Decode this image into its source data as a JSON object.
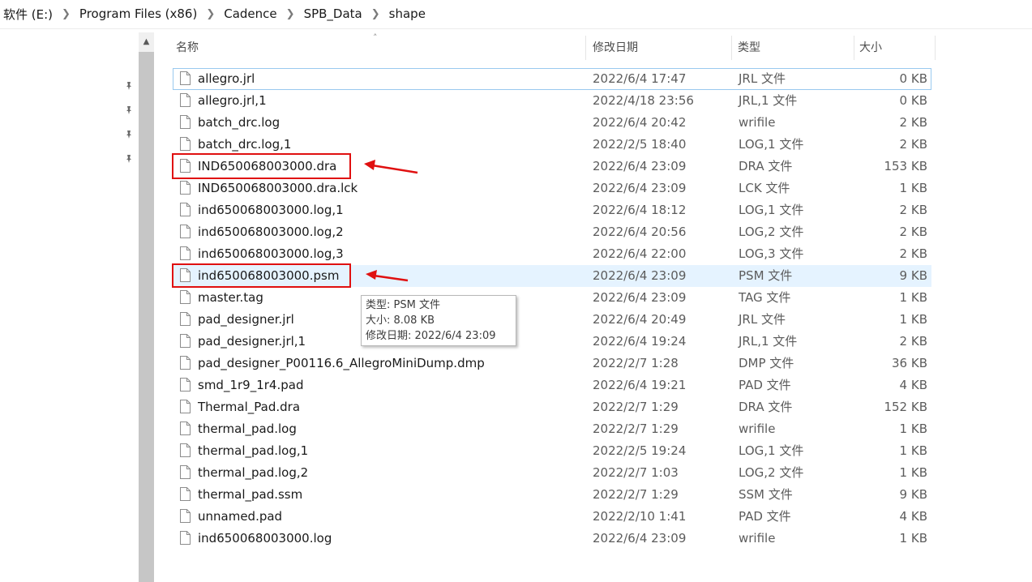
{
  "breadcrumb": [
    "软件 (E:)",
    "Program Files (x86)",
    "Cadence",
    "SPB_Data",
    "shape"
  ],
  "columns": {
    "name": "名称",
    "modified": "修改日期",
    "type": "类型",
    "size": "大小"
  },
  "files": [
    {
      "name": "allegro.jrl",
      "date": "2022/6/4 17:47",
      "type": "JRL 文件",
      "size": "0 KB"
    },
    {
      "name": "allegro.jrl,1",
      "date": "2022/4/18 23:56",
      "type": "JRL,1 文件",
      "size": "0 KB"
    },
    {
      "name": "batch_drc.log",
      "date": "2022/6/4 20:42",
      "type": "wrifile",
      "size": "2 KB"
    },
    {
      "name": "batch_drc.log,1",
      "date": "2022/2/5 18:40",
      "type": "LOG,1 文件",
      "size": "2 KB"
    },
    {
      "name": "IND650068003000.dra",
      "date": "2022/6/4 23:09",
      "type": "DRA 文件",
      "size": "153 KB"
    },
    {
      "name": "IND650068003000.dra.lck",
      "date": "2022/6/4 23:09",
      "type": "LCK 文件",
      "size": "1 KB"
    },
    {
      "name": "ind650068003000.log,1",
      "date": "2022/6/4 18:12",
      "type": "LOG,1 文件",
      "size": "2 KB"
    },
    {
      "name": "ind650068003000.log,2",
      "date": "2022/6/4 20:56",
      "type": "LOG,2 文件",
      "size": "2 KB"
    },
    {
      "name": "ind650068003000.log,3",
      "date": "2022/6/4 22:00",
      "type": "LOG,3 文件",
      "size": "2 KB"
    },
    {
      "name": "ind650068003000.psm",
      "date": "2022/6/4 23:09",
      "type": "PSM 文件",
      "size": "9 KB"
    },
    {
      "name": "master.tag",
      "date": "2022/6/4 23:09",
      "type": "TAG 文件",
      "size": "1 KB"
    },
    {
      "name": "pad_designer.jrl",
      "date": "2022/6/4 20:49",
      "type": "JRL 文件",
      "size": "1 KB"
    },
    {
      "name": "pad_designer.jrl,1",
      "date": "2022/6/4 19:24",
      "type": "JRL,1 文件",
      "size": "2 KB"
    },
    {
      "name": "pad_designer_P00116.6_AllegroMiniDump.dmp",
      "date": "2022/2/7 1:28",
      "type": "DMP 文件",
      "size": "36 KB"
    },
    {
      "name": "smd_1r9_1r4.pad",
      "date": "2022/6/4 19:21",
      "type": "PAD 文件",
      "size": "4 KB"
    },
    {
      "name": "Thermal_Pad.dra",
      "date": "2022/2/7 1:29",
      "type": "DRA 文件",
      "size": "152 KB"
    },
    {
      "name": "thermal_pad.log",
      "date": "2022/2/7 1:29",
      "type": "wrifile",
      "size": "1 KB"
    },
    {
      "name": "thermal_pad.log,1",
      "date": "2022/2/5 19:24",
      "type": "LOG,1 文件",
      "size": "1 KB"
    },
    {
      "name": "thermal_pad.log,2",
      "date": "2022/2/7 1:03",
      "type": "LOG,2 文件",
      "size": "1 KB"
    },
    {
      "name": "thermal_pad.ssm",
      "date": "2022/2/7 1:29",
      "type": "SSM 文件",
      "size": "9 KB"
    },
    {
      "name": "unnamed.pad",
      "date": "2022/2/10 1:41",
      "type": "PAD 文件",
      "size": "4 KB"
    },
    {
      "name": "ind650068003000.log",
      "date": "2022/6/4 23:09",
      "type": "wrifile",
      "size": "1 KB"
    }
  ],
  "tooltip": {
    "type_line": "类型: PSM 文件",
    "size_line": "大小: 8.08 KB",
    "date_line": "修改日期: 2022/6/4 23:09"
  },
  "icons": {
    "breadcrumb_separator": "chevron-right-icon",
    "nav_pin": "pin-icon",
    "file": "document-icon",
    "sort": "sort-caret-up-icon",
    "scroll_up": "scroll-up-arrow-icon"
  },
  "colors": {
    "annotation": "#e01010",
    "hover_row": "#e5f3ff",
    "focus_outline": "#99c9ef",
    "scrollbar_thumb": "#c6c6c6"
  }
}
